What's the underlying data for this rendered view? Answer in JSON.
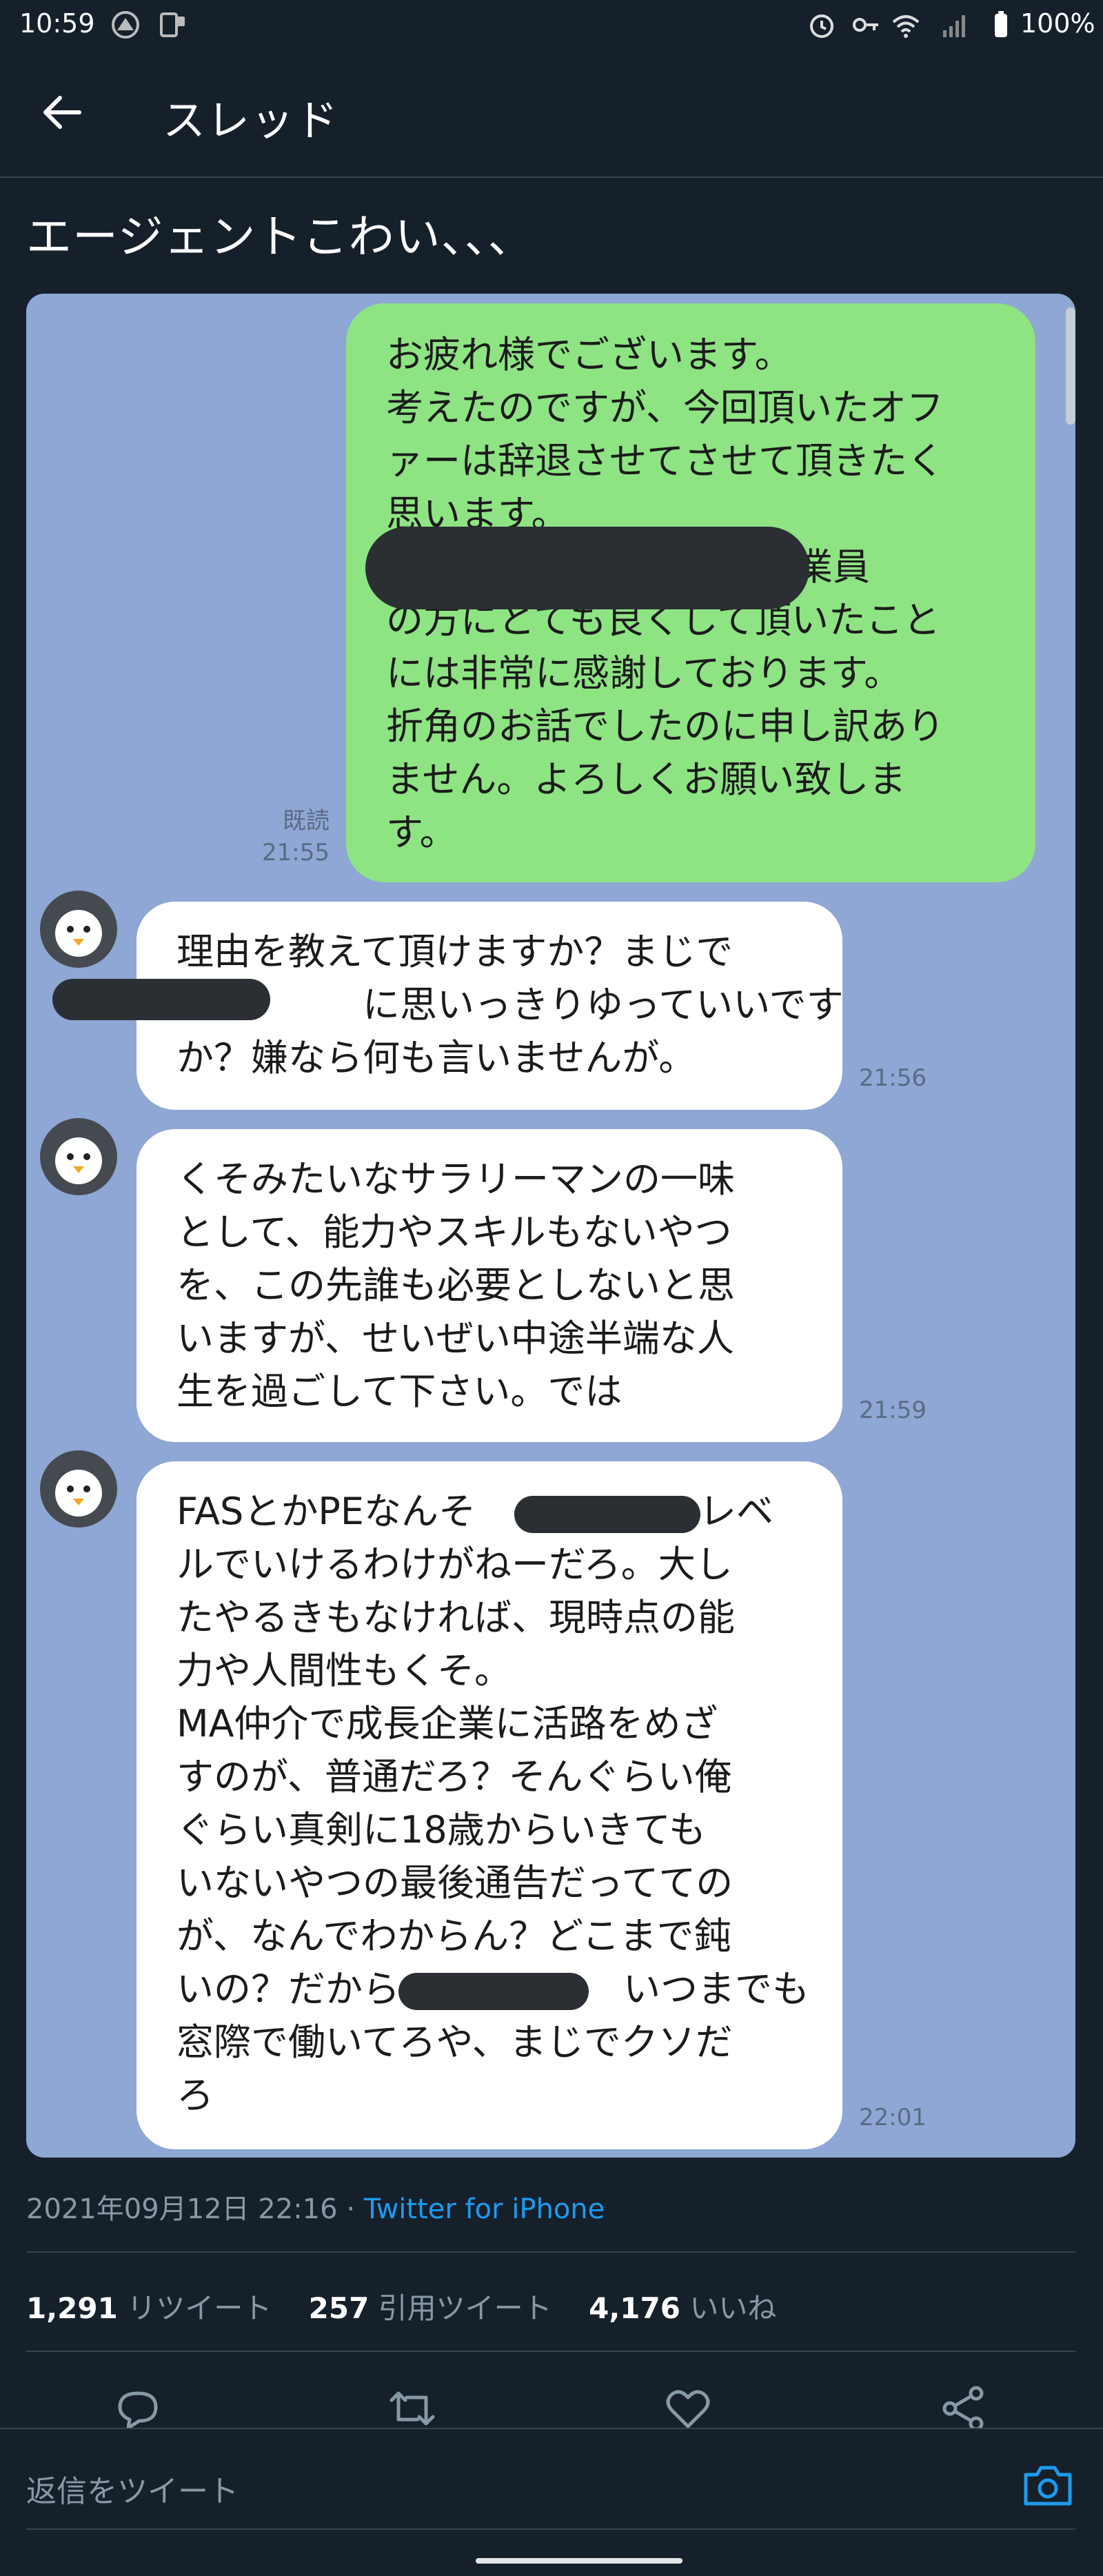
{
  "status_bar": {
    "time": "10:59",
    "battery": "100%",
    "icons": [
      "alarm-icon",
      "vpn-key-icon",
      "wifi-icon",
      "signal-icon",
      "battery-icon"
    ]
  },
  "header": {
    "title": "スレッド"
  },
  "tweet": {
    "text": "エージェントこわい、、、",
    "timestamp": "2021年09月12日 22:16",
    "source": "Twitter for iPhone",
    "stats": {
      "retweets_count": "1,291",
      "retweets_label": "リツイート",
      "quotes_count": "257",
      "quotes_label": "引用ツイート",
      "likes_count": "4,176",
      "likes_label": "いいね"
    }
  },
  "chat": {
    "sent": {
      "lines": [
        "お疲れ様でございます。",
        "考えたのですが、今回頂いたオフ",
        "ァーは辞退させてさせて頂きたく",
        "思います。",
        "　　　　　　　　役、従業員",
        "の方にとても良くして頂いたこと",
        "には非常に感謝しております。",
        "折角のお話でしたのに申し訳あり",
        "ません。よろしくお願い致しま",
        "す。"
      ],
      "read_label": "既読",
      "time": "21:55"
    },
    "received": [
      {
        "lines": [
          "理由を教えて頂けますか？まじで",
          "　　　　　に思いっきりゆっていいです",
          "か？嫌なら何も言いませんが。"
        ],
        "time": "21:56"
      },
      {
        "lines": [
          "くそみたいなサラリーマンの一味",
          "として、能力やスキルもないやつ",
          "を、この先誰も必要としないと思",
          "いますが、せいぜい中途半端な人",
          "生を過ごして下さい。では"
        ],
        "time": "21:59"
      },
      {
        "lines": [
          "FASとかPEなんそ　　　　　　レベ",
          "ルでいけるわけがねーだろ。大し",
          "たやるきもなければ、現時点の能",
          "力や人間性もくそ。",
          "MA仲介で成長企業に活路をめざ",
          "すのが、普通だろ？そんぐらい俺",
          "ぐらい真剣に18歳からいきても",
          "いないやつの最後通告だってての",
          "が、なんでわからん？どこまで鈍",
          "いの？だから　　　　　　いつまでも",
          "窓際で働いてろや、まじでクソだ",
          "ろ"
        ],
        "time": "22:01"
      }
    ]
  },
  "reply": {
    "placeholder": "返信をツイート"
  },
  "colors": {
    "background": "#15202b",
    "link": "#1d9bf0",
    "muted": "#8899a6",
    "chat_bg": "#8ea7d4",
    "sent_bubble": "#8ee383",
    "received_bubble": "#ffffff"
  }
}
